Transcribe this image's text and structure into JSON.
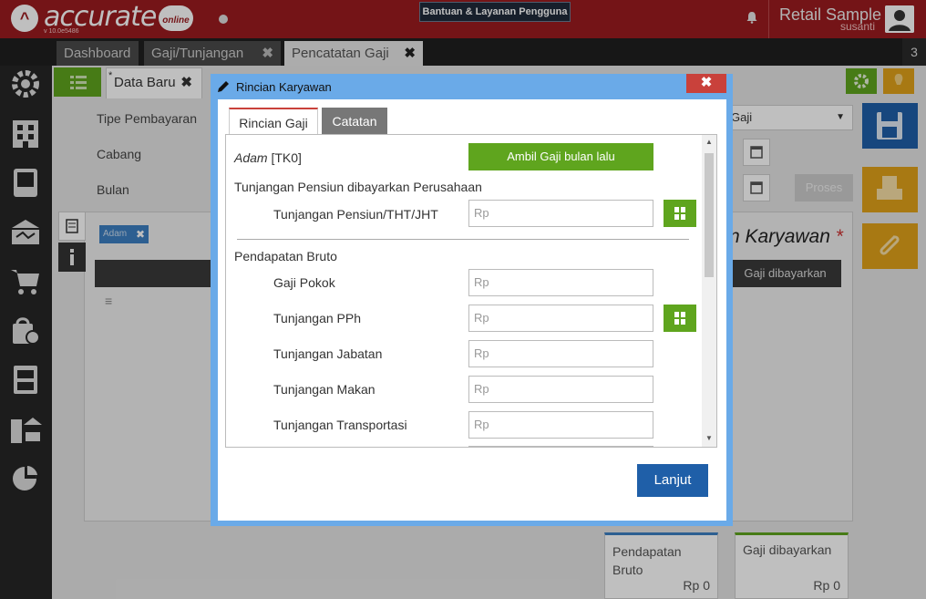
{
  "header": {
    "logo_text": "accurate",
    "logo_sub": "online",
    "version": "v 10.0e5486",
    "help_button": "Bantuan & Layanan Pengguna",
    "company": "Retail Sample",
    "user": "susanti"
  },
  "tabs": [
    {
      "label": "Dashboard"
    },
    {
      "label": "Gaji/Tunjangan",
      "close": "✖"
    },
    {
      "label": "Pencatatan Gaji",
      "close": "✖"
    }
  ],
  "tab_count": "3",
  "form": {
    "tab_label": "Data Baru",
    "tab_marker": "*",
    "tab_close": "✖",
    "tipe_label": "Tipe Pembayaran",
    "cabang_label": "Cabang",
    "bulan_label": "Bulan",
    "tipe_value": "Gaji",
    "proses_button": "Proses",
    "section_title": "n Karyawan",
    "required_mark": "*",
    "employee_chip": "Adam",
    "chip_close": "✖",
    "grid_col_gaji": "Gaji dibayarkan",
    "grid_row_marker": "≡"
  },
  "summary": {
    "pendapatan_label": "Pendapatan Bruto",
    "pendapatan_value": "Rp 0",
    "gaji_label": "Gaji dibayarkan",
    "gaji_value": "Rp 0"
  },
  "modal": {
    "title": "Rincian Karyawan",
    "close": "✖",
    "tabs": {
      "rincian": "Rincian Gaji",
      "catatan": "Catatan"
    },
    "employee_name": "Adam",
    "employee_code": "[TK0]",
    "ambil_button": "Ambil Gaji bulan lalu",
    "pensiun_section": "Tunjangan Pensiun dibayarkan Perusahaan",
    "pensiun_field": "Tunjangan Pensiun/THT/JHT",
    "bruto_section": "Pendapatan Bruto",
    "fields": {
      "gaji_pokok": "Gaji Pokok",
      "tunjangan_pph": "Tunjangan PPh",
      "tunjangan_jabatan": "Tunjangan Jabatan",
      "tunjangan_makan": "Tunjangan Makan",
      "tunjangan_transportasi": "Tunjangan Transportasi"
    },
    "placeholder": "Rp",
    "lanjut_button": "Lanjut"
  }
}
